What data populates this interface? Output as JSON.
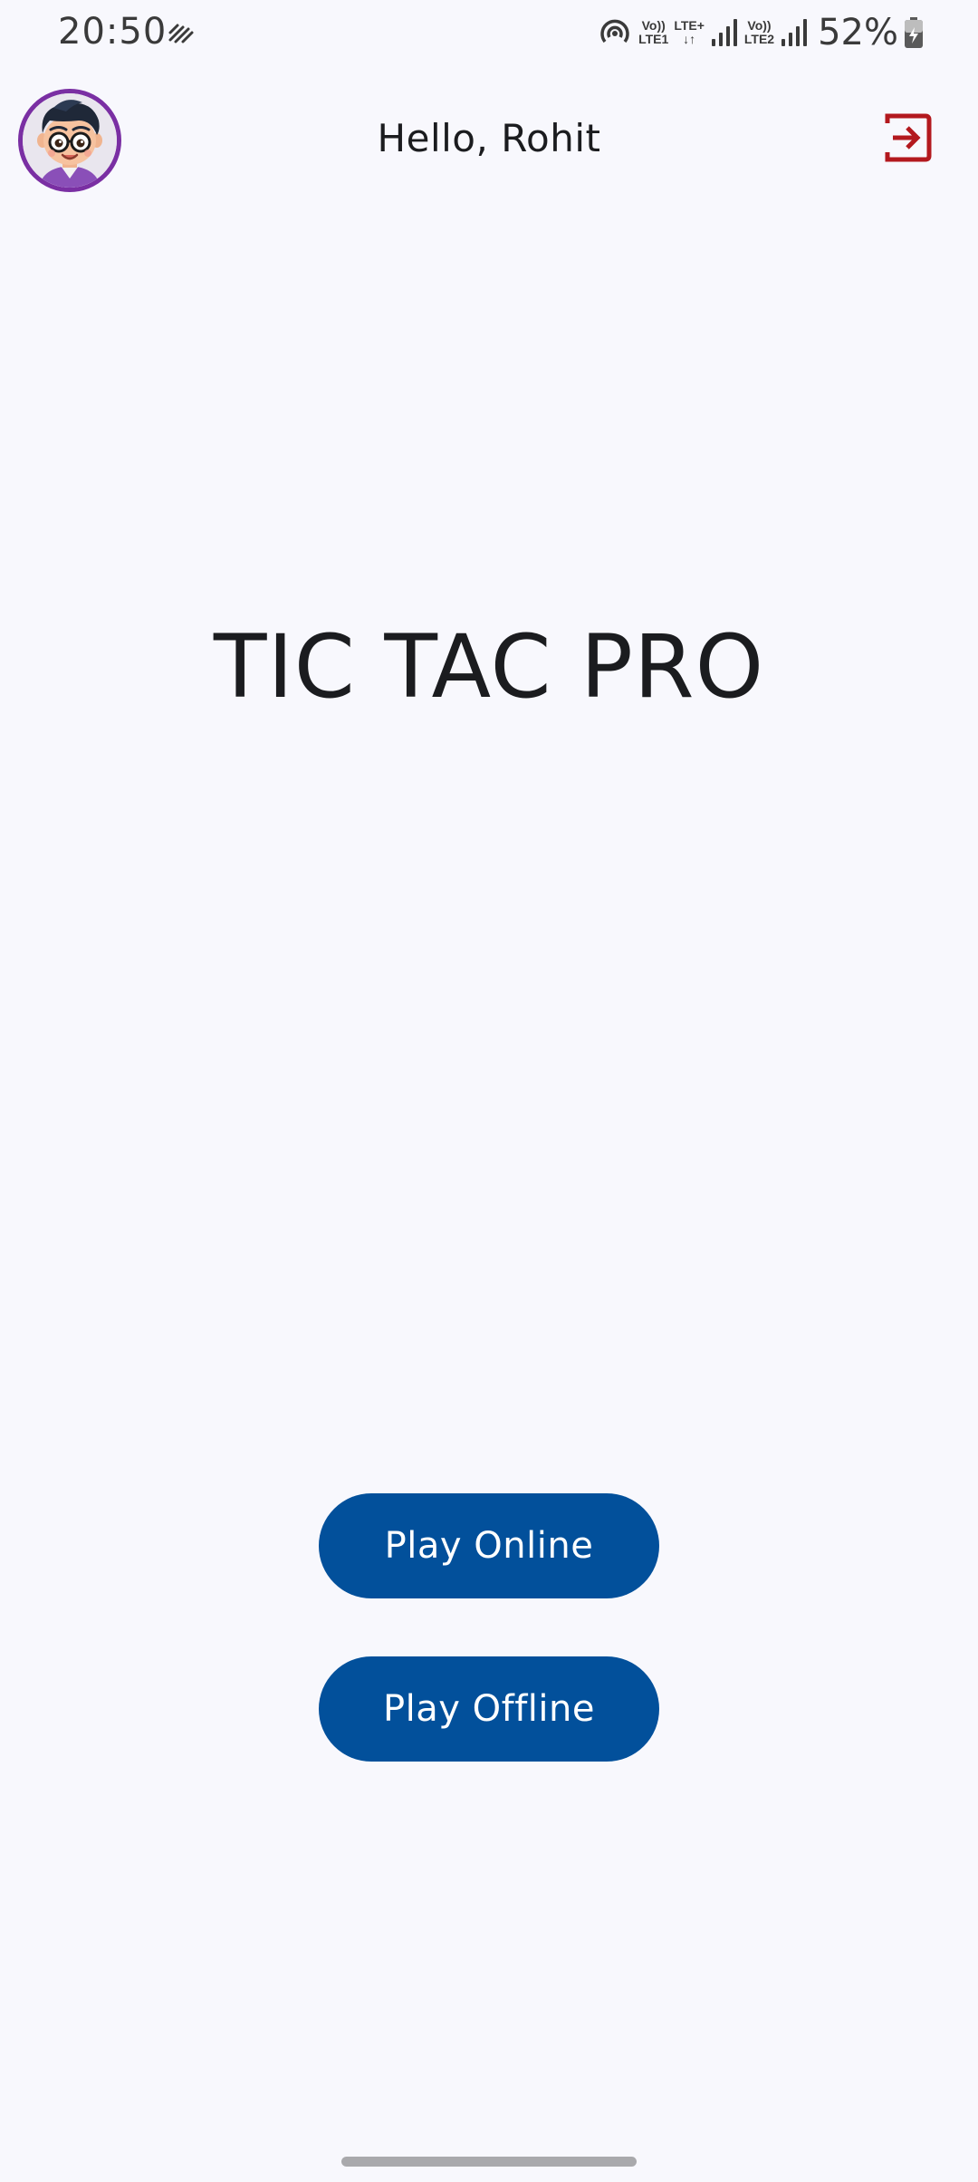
{
  "status_bar": {
    "time": "20:50",
    "sim1_top": "Vo))",
    "sim1_bottom": "LTE1",
    "net_top": "LTE+",
    "net_bottom": "↓↑",
    "sim2_top": "Vo))",
    "sim2_bottom": "LTE2",
    "battery": "52%",
    "icons": [
      "sync-icon",
      "hotspot-icon",
      "signal-icon",
      "signal-icon",
      "battery-charging-icon"
    ]
  },
  "app_bar": {
    "greeting": "Hello, Rohit",
    "avatar_icon": "user-avatar",
    "logout_icon": "logout-icon"
  },
  "main": {
    "title": "TIC TAC PRO"
  },
  "actions": {
    "play_online": "Play Online",
    "play_offline": "Play Offline"
  },
  "colors": {
    "background": "#f8f8fd",
    "primary": "#02509b",
    "logout": "#b3191e",
    "avatar_border": "#7a2fa3"
  }
}
